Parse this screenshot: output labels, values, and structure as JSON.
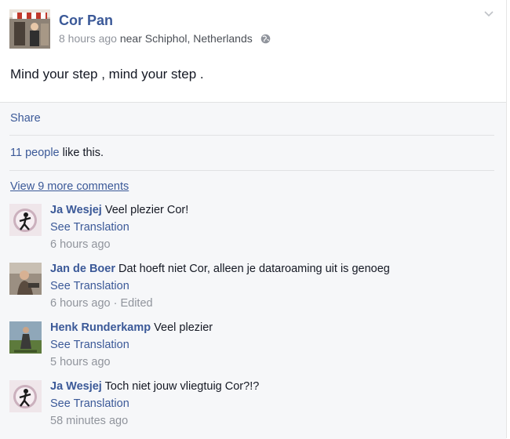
{
  "post": {
    "author": "Cor Pan",
    "time": "8 hours ago",
    "near_label": "near",
    "location": "Schiphol, Netherlands",
    "status_text": "Mind your step , mind your step ."
  },
  "actions": {
    "share": "Share"
  },
  "likes": {
    "count_text": "11 people",
    "suffix": "like this."
  },
  "comments_section": {
    "view_more": "View 9 more comments",
    "items": [
      {
        "name": "Ja Wesjej",
        "text": "Veel plezier Cor!",
        "translation": "See Translation",
        "time": "6 hours ago"
      },
      {
        "name": "Jan de Boer",
        "text": "Dat hoeft niet Cor, alleen je dataroaming uit is genoeg",
        "translation": "See Translation",
        "time": "6 hours ago · Edited"
      },
      {
        "name": "Henk Runderkamp",
        "text": "Veel plezier",
        "translation": "See Translation",
        "time": "5 hours ago"
      },
      {
        "name": "Ja Wesjej",
        "text": "Toch niet jouw vliegtuig Cor?!?",
        "translation": "See Translation",
        "time": "58 minutes ago"
      }
    ]
  },
  "icons": {
    "menu": "chevron-down-icon",
    "privacy": "globe-icon"
  },
  "colors": {
    "link": "#3b5998",
    "muted": "#90949c",
    "band_bg": "#f6f7f9"
  }
}
